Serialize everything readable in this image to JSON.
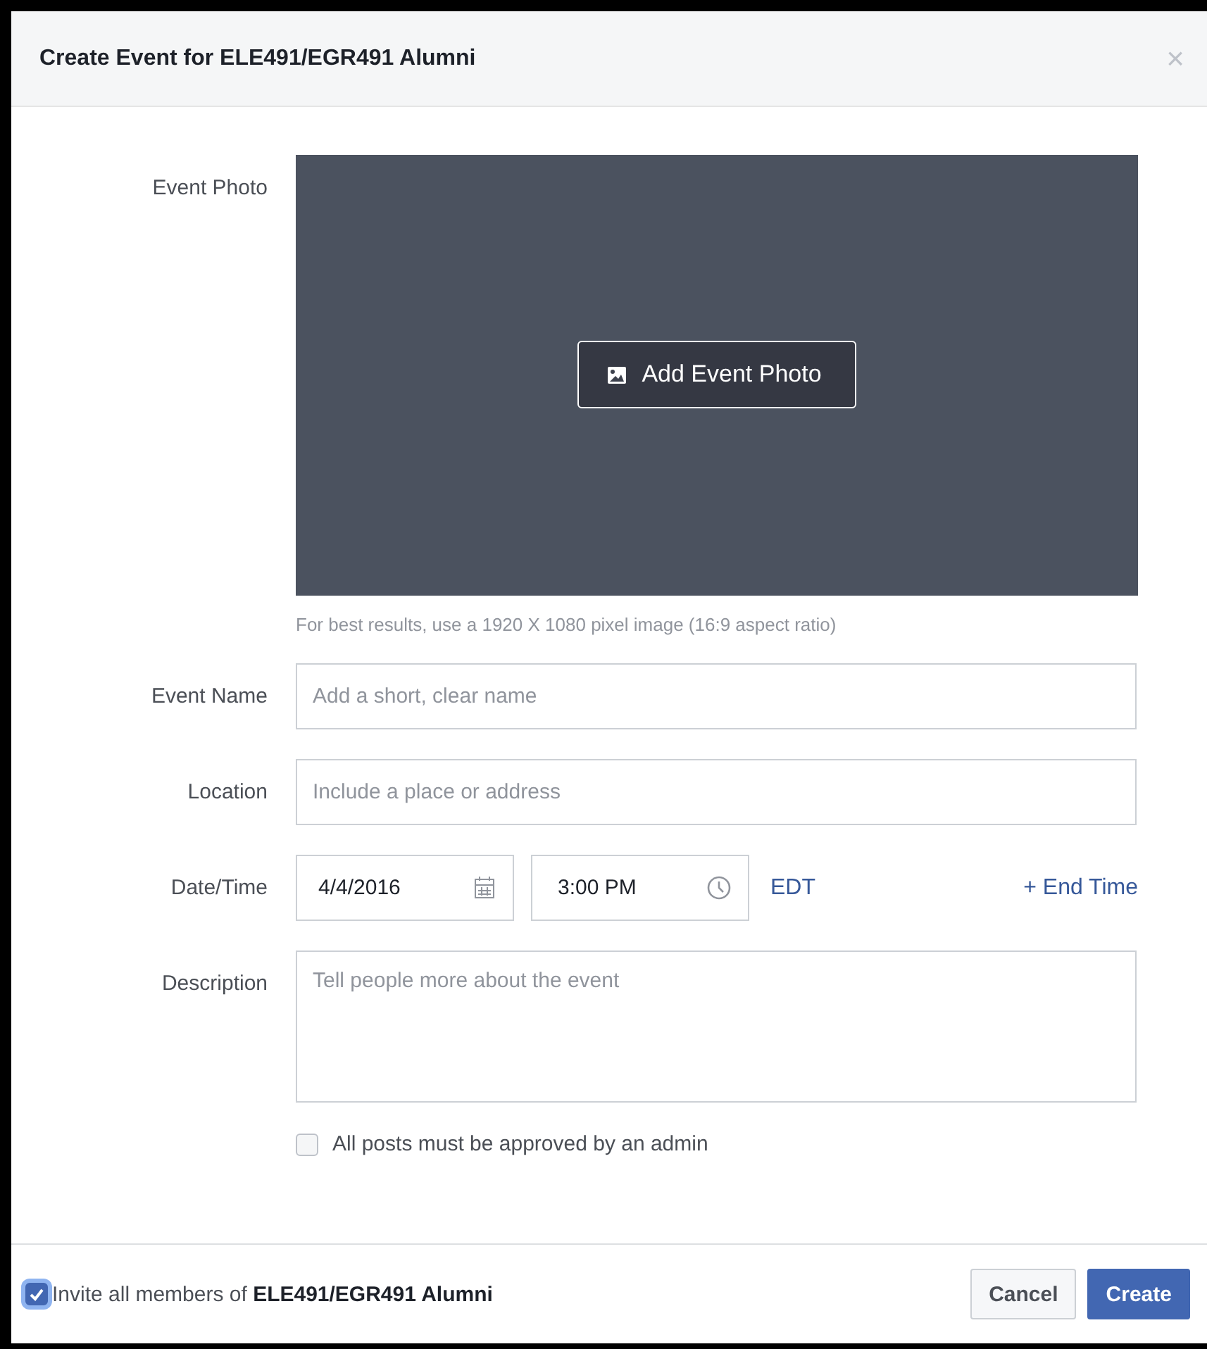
{
  "dialog": {
    "title": "Create Event for ELE491/EGR491 Alumni",
    "close": "×"
  },
  "photo": {
    "label": "Event Photo",
    "button": "Add Event Photo",
    "hint": "For best results, use a 1920 X 1080 pixel image (16:9 aspect ratio)"
  },
  "event_name": {
    "label": "Event Name",
    "placeholder": "Add a short, clear name"
  },
  "location": {
    "label": "Location",
    "placeholder": "Include a place or address"
  },
  "date_time": {
    "label": "Date/Time",
    "date": "4/4/2016",
    "time": "3:00 PM",
    "timezone": "EDT",
    "end_time_link": "+ End Time"
  },
  "description": {
    "label": "Description",
    "placeholder": "Tell people more about the event"
  },
  "approval": {
    "label": "All posts must be approved by an admin",
    "checked": false
  },
  "footer": {
    "invite": {
      "label": "Invite all members of **ELE491/EGR491 Alumni**",
      "checked": true
    },
    "buttons": [
      {
        "label": "Cancel",
        "kind": "secondary"
      },
      {
        "label": "Create",
        "kind": "primary"
      }
    ]
  }
}
